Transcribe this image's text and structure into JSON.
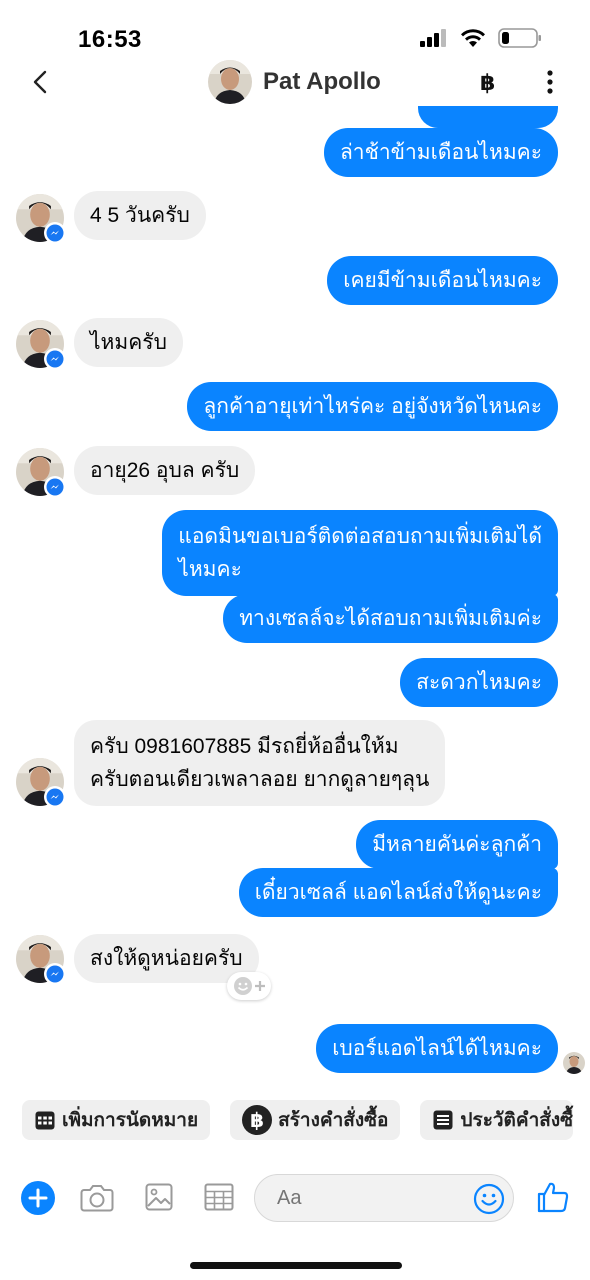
{
  "status_bar": {
    "time": "16:53"
  },
  "header": {
    "contact_name": "Pat Apollo",
    "currency_symbol": "฿"
  },
  "messages": [
    {
      "id": 0,
      "from": "me",
      "text": "ล่าช้าข้ามเดือนไหมคะ"
    },
    {
      "id": 1,
      "from": "them",
      "text": "4  5  วันครับ"
    },
    {
      "id": 2,
      "from": "me",
      "text": "เคยมีข้ามเดือนไหมคะ"
    },
    {
      "id": 3,
      "from": "them",
      "text": "ไหมครับ"
    },
    {
      "id": 4,
      "from": "me",
      "text": "ลูกค้าอายุเท่าไหร่คะ อยู่จังหวัดไหนคะ"
    },
    {
      "id": 5,
      "from": "them",
      "text": "อายุ26  อุบล ครับ"
    },
    {
      "id": 6,
      "from": "me",
      "line1": "แอดมินขอเบอร์ติดต่อสอบถามเพิ่มเติมได้",
      "line2": "ไหมคะ"
    },
    {
      "id": 7,
      "from": "me",
      "text": "ทางเซลล์จะได้สอบถามเพิ่มเติมค่ะ"
    },
    {
      "id": 8,
      "from": "me",
      "text": "สะดวกไหมคะ"
    },
    {
      "id": 9,
      "from": "them",
      "line1": "ครับ   0981607885  มีรถยี่ห้ออื่นให้ม",
      "line2": "ครับตอนเดียวเพลาลอย ยากดูลายๆลุน"
    },
    {
      "id": 10,
      "from": "me",
      "text": "มีหลายคันค่ะลูกค้า"
    },
    {
      "id": 11,
      "from": "me",
      "text": "เดี๋ยวเซลล์ แอดไลน์ส่งให้ดูนะคะ"
    },
    {
      "id": 12,
      "from": "them",
      "text": "สงให้ดูหน่อยครับ"
    },
    {
      "id": 13,
      "from": "me",
      "text": "เบอร์แอดไลน์ได้ไหมคะ"
    }
  ],
  "quick_actions": [
    {
      "label": "เพิ่มการนัดหมาย",
      "icon": "calendar-icon"
    },
    {
      "label": "สร้างคำสั่งซื้อ",
      "icon": "baht-icon"
    },
    {
      "label": "ประวัติคำสั่งซื้",
      "icon": "list-icon"
    }
  ],
  "composer": {
    "placeholder": "Aa"
  },
  "colors": {
    "accent": "#0a84ff",
    "incoming_bg": "#efefef",
    "messenger_badge": "#1877f2"
  }
}
